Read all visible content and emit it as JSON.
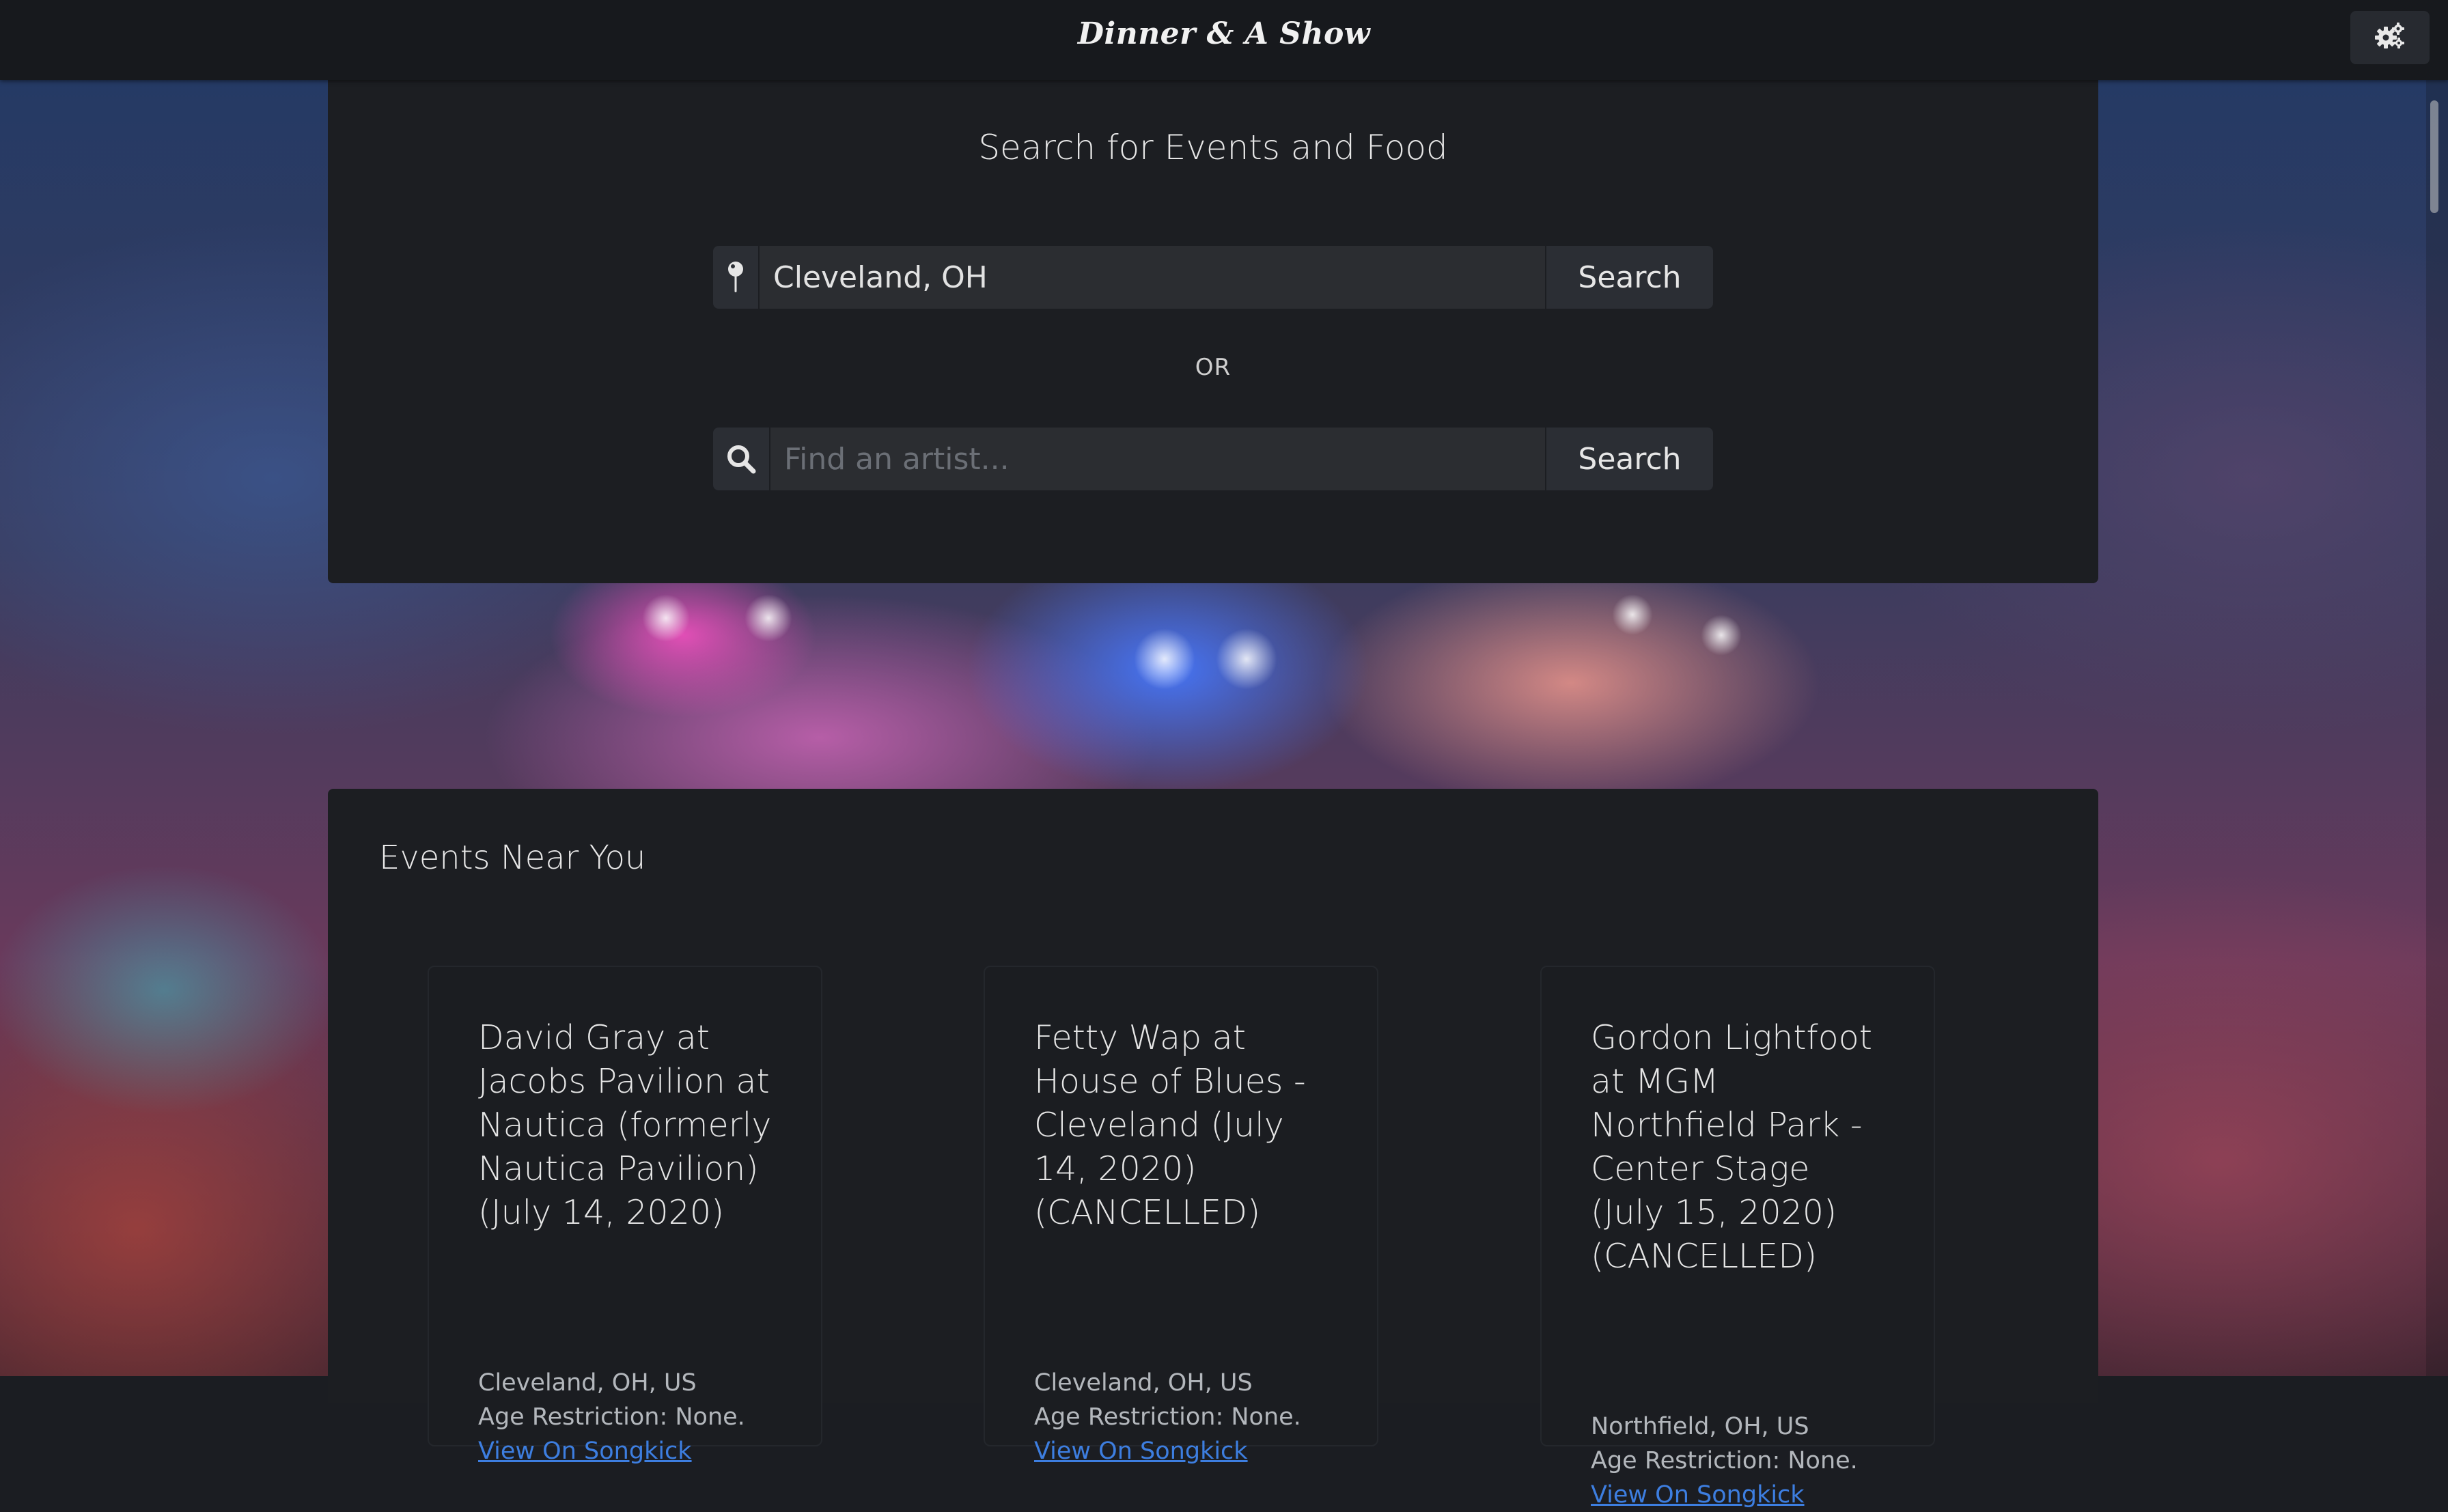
{
  "header": {
    "brand": "Dinner & A Show",
    "settings_icon": "gears-icon"
  },
  "search": {
    "title": "Search for Events and Food",
    "location": {
      "icon": "map-pin-icon",
      "value": "Cleveland, OH",
      "button_label": "Search"
    },
    "or_label": "OR",
    "artist": {
      "icon": "search-icon",
      "placeholder": "Find an artist...",
      "value": "",
      "button_label": "Search"
    }
  },
  "events": {
    "title": "Events Near You",
    "items": [
      {
        "name": "David Gray at Jacobs Pavilion at Nautica (formerly Nautica Pavilion) (July 14, 2020)",
        "location": "Cleveland, OH, US",
        "age_restriction": "Age Restriction: None.",
        "link_label": "View On Songkick"
      },
      {
        "name": "Fetty Wap at House of Blues - Cleveland (July 14, 2020) (CANCELLED)",
        "location": "Cleveland, OH, US",
        "age_restriction": "Age Restriction: None.",
        "link_label": "View On Songkick"
      },
      {
        "name": "Gordon Lightfoot at MGM Northfield Park - Center Stage (July 15, 2020) (CANCELLED)",
        "location": "Northfield, OH, US",
        "age_restriction": "Age Restriction: None.",
        "link_label": "View On Songkick"
      }
    ]
  },
  "colors": {
    "navbar": "#17191d",
    "card": "#1c1e22",
    "link": "#3d7ee0"
  }
}
